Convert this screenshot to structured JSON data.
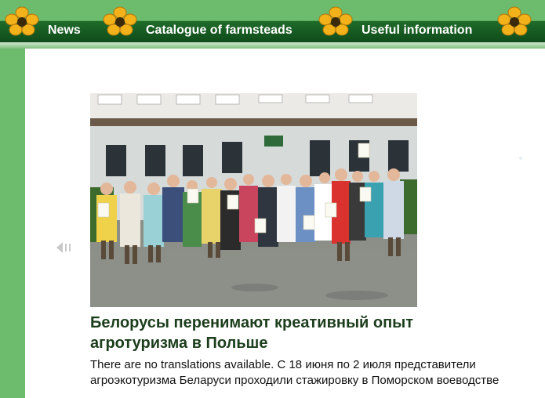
{
  "nav": {
    "items": [
      {
        "label": "News"
      },
      {
        "label": "Catalogue of farmsteads"
      },
      {
        "label": "Useful information"
      }
    ]
  },
  "article": {
    "title": "Белорусы перенимают креативный опыт агротуризма в Польше",
    "teaser": "There are no translations available. С 18 июня по 2 июля представители агроэкотуризма Беларуси проходили стажировку в Поморском воеводстве"
  },
  "icons": {
    "logo": "flower-icon",
    "slider_prev": "slider-prev-icon"
  },
  "colors": {
    "nav_bar": "#1f6b2a",
    "nav_background": "#6dbb6d",
    "flower_petal": "#f3b21a",
    "headline": "#1c3d1c"
  }
}
